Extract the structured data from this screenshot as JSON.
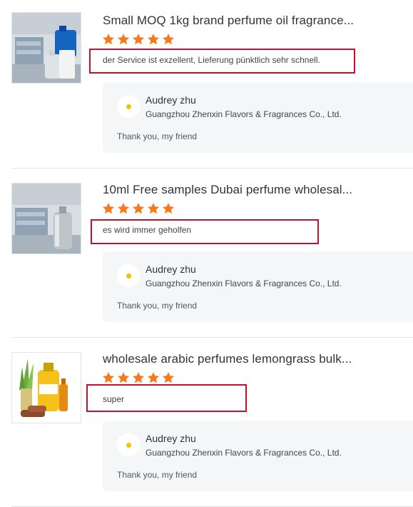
{
  "reviews": [
    {
      "product": "Small MOQ 1kg brand perfume oil fragrance...",
      "rating": 5,
      "comment": "der Service ist exzellent, Lieferung pünktlich sehr schnell.",
      "reply": {
        "name": "Audrey zhu",
        "company": "Guangzhou Zhenxin Flavors & Fragrances Co., Ltd.",
        "text": "Thank you, my friend"
      }
    },
    {
      "product": "10ml Free samples Dubai perfume wholesal...",
      "rating": 5,
      "comment": "es wird immer geholfen",
      "reply": {
        "name": "Audrey zhu",
        "company": "Guangzhou Zhenxin Flavors & Fragrances Co., Ltd.",
        "text": "Thank you, my friend"
      }
    },
    {
      "product": "wholesale arabic perfumes lemongrass bulk...",
      "rating": 5,
      "comment": "super",
      "reply": {
        "name": "Audrey zhu",
        "company": "Guangzhou Zhenxin Flavors & Fragrances Co., Ltd.",
        "text": "Thank you, my friend"
      }
    }
  ],
  "colors": {
    "star": "#f57a1f",
    "highlight": "#c8102e",
    "reply_bg": "#f5f6f8"
  },
  "icons": {
    "rating": "star-icon",
    "avatar": "seller-avatar"
  }
}
